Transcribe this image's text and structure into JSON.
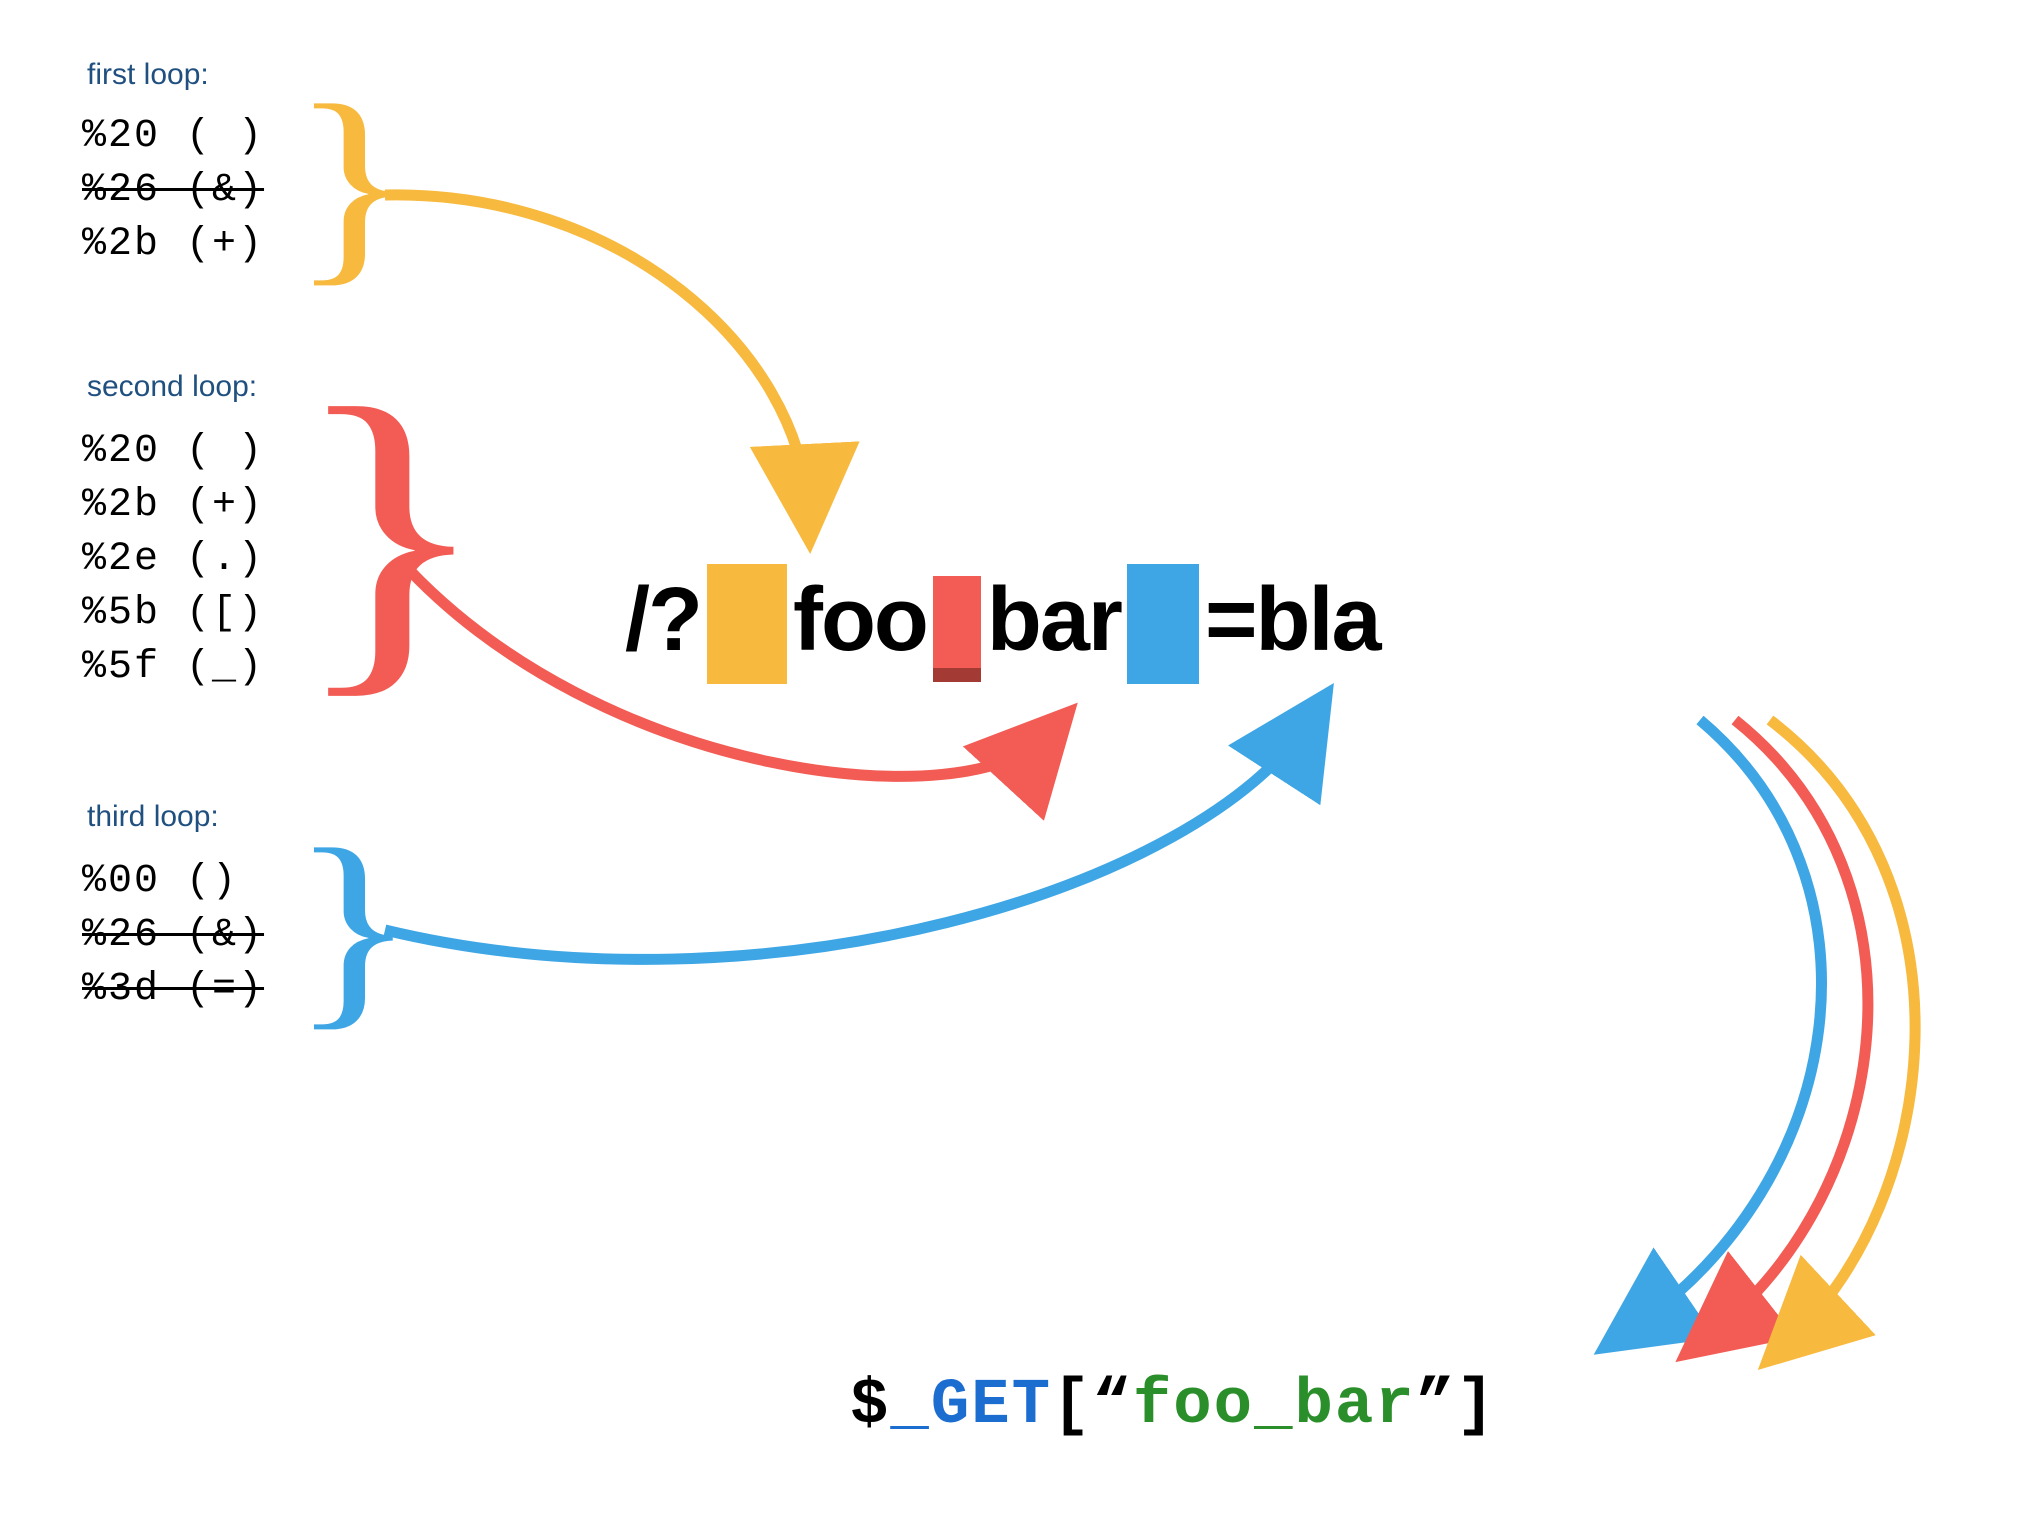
{
  "colors": {
    "yellow": "#f7b93e",
    "red": "#f25c54",
    "blue": "#3ea6e5",
    "title": "#205080",
    "black": "#000000",
    "php_blue": "#1c6dd0",
    "php_green": "#2a8f2a"
  },
  "loop1": {
    "title": "first loop:",
    "items": [
      {
        "text": "%20 ( )",
        "struck": false
      },
      {
        "text": "%26 (&)",
        "struck": true
      },
      {
        "text": "%2b (+)",
        "struck": false
      }
    ]
  },
  "loop2": {
    "title": "second loop:",
    "items": [
      {
        "text": "%20 ( )",
        "struck": false
      },
      {
        "text": "%2b (+)",
        "struck": false
      },
      {
        "text": "%2e (.)",
        "struck": false
      },
      {
        "text": "%5b ([)",
        "struck": false
      },
      {
        "text": "%5f (_)",
        "struck": false
      }
    ]
  },
  "loop3": {
    "title": "third loop:",
    "items": [
      {
        "text": "%00 ()",
        "struck": false
      },
      {
        "text": "%26 (&)",
        "struck": true
      },
      {
        "text": "%3d (=)",
        "struck": true
      }
    ]
  },
  "center": {
    "prefix": "/?",
    "seg1": "foo",
    "seg2": "bar",
    "suffix": "=bla"
  },
  "bottom": {
    "dollar": "$",
    "underscore": "_",
    "get": "GET",
    "openq": "[“",
    "key": "foo_bar",
    "closeq": "”]"
  }
}
